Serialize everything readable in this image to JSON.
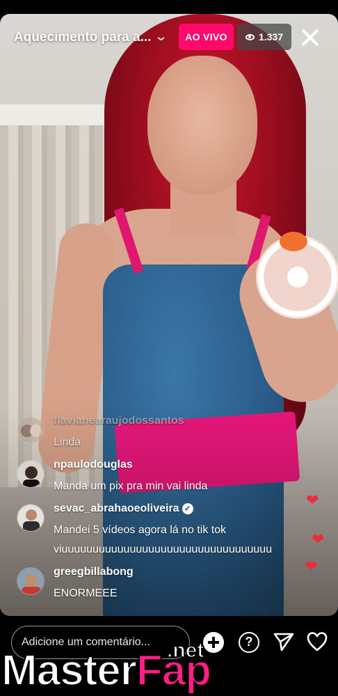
{
  "header": {
    "title": "Aquecimento para a...",
    "live_label": "AO VIVO",
    "viewer_count": "1.337"
  },
  "comments": [
    {
      "username": "flavianearaujodossantos",
      "text": "Linda",
      "verified": false,
      "faded": true
    },
    {
      "username": "npaulodouglas",
      "text": "Manda um pix pra min  vai linda",
      "verified": false,
      "faded": false
    },
    {
      "username": "sevac_abrahaoeoliveira",
      "text": "Mandei 5 vídeos agora lá no tik tok viuuuuuuuuuuuuuuuuuuuuuuuuuuuuuuuuuu",
      "verified": true,
      "faded": false
    },
    {
      "username": "greegbillabong",
      "text": "ENORMEEE",
      "verified": false,
      "faded": false
    }
  ],
  "footer": {
    "comment_placeholder": "Adicione um comentário..."
  },
  "watermark": {
    "part1": "Master",
    "part2": "Fap",
    "suffix": ".net"
  },
  "colors": {
    "live_badge": "#ff0a6c",
    "heart_reaction": "#ee2b3b",
    "watermark_accent": "#ff1e84"
  },
  "icons": [
    "eye-icon",
    "close-icon",
    "chevron-down-icon",
    "verified-icon",
    "add-icon",
    "question-icon",
    "send-icon",
    "heart-icon"
  ]
}
